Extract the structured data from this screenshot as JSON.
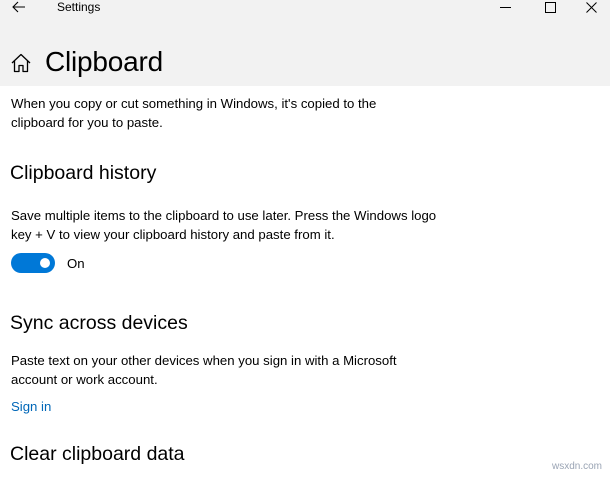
{
  "window": {
    "title": "Settings"
  },
  "page": {
    "title": "Clipboard",
    "intro": "When you copy or cut something in Windows, it's copied to the clipboard for you to paste."
  },
  "history": {
    "heading": "Clipboard history",
    "description": "Save multiple items to the clipboard to use later. Press the Windows logo key + V to view your clipboard history and paste from it.",
    "toggle_state": "On",
    "toggle_on": true
  },
  "sync": {
    "heading": "Sync across devices",
    "description": "Paste text on your other devices when you sign in with a Microsoft account or work account.",
    "link": "Sign in"
  },
  "clear": {
    "heading": "Clear clipboard data"
  },
  "colors": {
    "accent": "#0078d7",
    "link": "#0067b8",
    "header_background": "#f2f2f2"
  },
  "icons": {
    "back": "arrow-left-icon",
    "home": "home-icon",
    "minimize": "minimize-icon",
    "maximize": "maximize-icon",
    "close": "close-icon"
  },
  "watermark": "wsxdn.com"
}
